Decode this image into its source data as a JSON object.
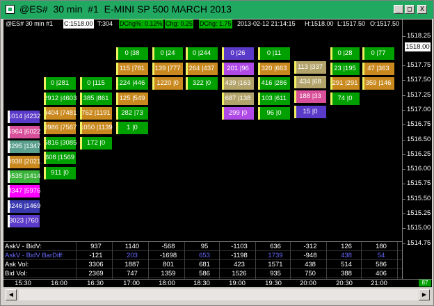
{
  "window": {
    "title": "@ES#  30 min  #1  E-MINI SP 500 MARCH 2013",
    "min_label": "_",
    "max_label": "□",
    "close_label": "X"
  },
  "infobar": {
    "symbol": "@ES#  30 min  #1",
    "close": "C:1518.00",
    "ticks": "T:304",
    "dchg_pct": "DChg%: 0.12%",
    "chg": "Chg: 0.25",
    "dchg": "DChg: 1.75",
    "datetime": "2013-02-12 21:14:15",
    "high": "H:1518.00",
    "low": "L:1517.50",
    "open": "O:1517.50"
  },
  "price_axis": {
    "labels": [
      "1518.25",
      "1517.75",
      "1517.50",
      "1517.25",
      "1517.00",
      "1516.75",
      "1516.50",
      "1516.25",
      "1516.00",
      "1515.75",
      "1515.50",
      "1515.25",
      "1515.00",
      "1514.75"
    ],
    "current": "1518.00"
  },
  "colors": {
    "green": "#00a000",
    "light_green": "#3ab33a",
    "olive": "#b2a36a",
    "orange": "#c9891e",
    "teal": "#5aa08c",
    "pink": "#d9509a",
    "blue_violet": "#5a3ac8",
    "magenta": "#ff00ff",
    "mauve": "#b04ae6",
    "lavender": "#c877c8"
  },
  "columns": [
    {
      "time": "15:30",
      "cells": [
        {
          "text": "1014 |4232",
          "color": "#5a3ac8",
          "bar": "#ffffff"
        },
        {
          "text": "6964 |6022",
          "color": "#d9509a",
          "bar": "#ffffff"
        },
        {
          "text": "8295 |1347",
          "color": "#5aa08c",
          "bar": "#ffffff"
        },
        {
          "text": "0938 |2021",
          "color": "#c9891e",
          "bar": "#ffffff"
        },
        {
          "text": "6535 |1414",
          "color": "#3ab33a",
          "bar": "#ffffff"
        },
        {
          "text": "8347 |5976",
          "color": "#ff00ff",
          "bar": "#ffffff"
        },
        {
          "text": "3246 |1469",
          "color": "#3a3ab0",
          "bar": "#ffffff"
        },
        {
          "text": "3023 |760",
          "color": "#5a3ac8",
          "bar": "#ffffff"
        }
      ]
    },
    {
      "time": "16:00",
      "cells": [
        {
          "text": "0 |281",
          "color": "#00a000"
        },
        {
          "text": "2912 |4603",
          "color": "#00a000"
        },
        {
          "text": "9404 |7481",
          "color": "#c9891e"
        },
        {
          "text": "0986 |7567",
          "color": "#c9891e"
        },
        {
          "text": "5816 |3085",
          "color": "#00a000"
        },
        {
          "text": "608 |1569",
          "color": "#00a000"
        },
        {
          "text": "911 |0",
          "color": "#00a000"
        }
      ]
    },
    {
      "time": "16:30",
      "cells": [
        {
          "text": "0 |115",
          "color": "#00a000"
        },
        {
          "text": "385 |861",
          "color": "#00a000"
        },
        {
          "text": "762 |1191",
          "color": "#c9891e"
        },
        {
          "text": "1050 |1139",
          "color": "#c9891e"
        },
        {
          "text": "172 |0",
          "color": "#00a000"
        }
      ]
    },
    {
      "time": "17:00",
      "cells": [
        {
          "text": "0 |38",
          "color": "#00a000"
        },
        {
          "text": "115 |781",
          "color": "#c9891e"
        },
        {
          "text": "224 |446",
          "color": "#00a000"
        },
        {
          "text": "125 |549",
          "color": "#c9891e"
        },
        {
          "text": "282 |73",
          "color": "#00a000"
        },
        {
          "text": "1 |0",
          "color": "#00a000"
        }
      ]
    },
    {
      "time": "18:00",
      "cells": [
        {
          "text": "0 |24",
          "color": "#00a000"
        },
        {
          "text": "139 |777",
          "color": "#c9891e"
        },
        {
          "text": "1220 |0",
          "color": "#c9891e"
        }
      ]
    },
    {
      "time": "18:30",
      "cells": [
        {
          "text": "0 |244",
          "color": "#00a000"
        },
        {
          "text": "264 |437",
          "color": "#c9891e"
        },
        {
          "text": "322 |0",
          "color": "#00a000"
        }
      ]
    },
    {
      "time": "19:00",
      "cells": [
        {
          "text": "0 |26",
          "color": "#5a3ac8"
        },
        {
          "text": "201 |96",
          "color": "#b04ae6"
        },
        {
          "text": "439 |163",
          "color": "#b2a36a"
        },
        {
          "text": "687 |138",
          "color": "#b2a36a"
        },
        {
          "text": "299 |0",
          "color": "#b04ae6"
        }
      ]
    },
    {
      "time": "19:30",
      "cells": [
        {
          "text": "0 |11",
          "color": "#00a000"
        },
        {
          "text": "320 |663",
          "color": "#c9891e"
        },
        {
          "text": "416 |286",
          "color": "#00a000"
        },
        {
          "text": "103 |611",
          "color": "#00a000"
        },
        {
          "text": "96 |0",
          "color": "#00a000"
        }
      ]
    },
    {
      "time": "20:00",
      "cells": [
        {
          "text": "113 |337",
          "color": "#b2a36a"
        },
        {
          "text": "434 |68",
          "color": "#b2a36a"
        },
        {
          "text": "188 |33",
          "color": "#d9509a"
        },
        {
          "text": "15 |0",
          "color": "#5a3ac8"
        }
      ]
    },
    {
      "time": "20:30",
      "cells": [
        {
          "text": "0 |28",
          "color": "#00a000"
        },
        {
          "text": "23 |195",
          "color": "#00a000"
        },
        {
          "text": "291 |291",
          "color": "#c9891e"
        },
        {
          "text": "74 |0",
          "color": "#00a000"
        }
      ]
    },
    {
      "time": "21:00",
      "cells": [
        {
          "text": "0 |77",
          "color": "#00a000"
        },
        {
          "text": "47 |363",
          "color": "#c9891e"
        },
        {
          "text": "359 |146",
          "color": "#c9891e"
        }
      ]
    }
  ],
  "stats": {
    "labels": [
      "AskV - BidV:",
      "AskV - BidV BarDiff:",
      "Ask Vol:",
      "Bid Vol:"
    ],
    "rows": [
      [
        "937",
        "1140",
        "-568",
        "95",
        "-1103",
        "636",
        "-312",
        "126",
        "180"
      ],
      [
        "-121",
        "203",
        "-1698",
        "653",
        "-1198",
        "1739",
        "-948",
        "438",
        "54"
      ],
      [
        "3306",
        "1887",
        "801",
        "681",
        "423",
        "1571",
        "438",
        "514",
        "586"
      ],
      [
        "2369",
        "747",
        "1359",
        "586",
        "1526",
        "935",
        "750",
        "388",
        "406"
      ]
    ],
    "bardiff_colors": [
      "#ffffff",
      "#6a6aff",
      "#ffffff",
      "#6a6aff",
      "#ffffff",
      "#6a6aff",
      "#ffffff",
      "#6a6aff",
      "#6a6aff"
    ]
  },
  "time_axis": [
    "15:30",
    "16:00",
    "16:30",
    "17:00",
    "18:00",
    "18:30",
    "19:00",
    "19:30",
    "20:00",
    "20:30",
    "21:00"
  ],
  "badge": "87"
}
